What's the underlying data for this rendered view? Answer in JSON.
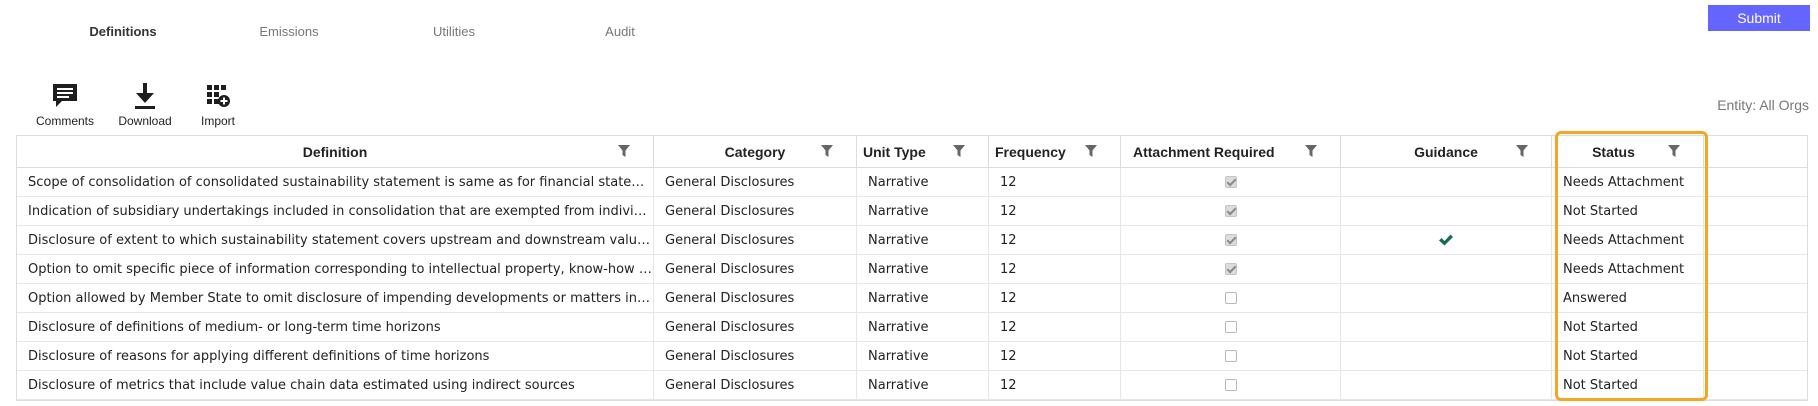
{
  "tabs": [
    {
      "label": "Definitions",
      "active": true
    },
    {
      "label": "Emissions",
      "active": false
    },
    {
      "label": "Utilities",
      "active": false
    },
    {
      "label": "Audit",
      "active": false
    }
  ],
  "submit_label": "Submit",
  "toolbar": {
    "comments_label": "Comments",
    "download_label": "Download",
    "import_label": "Import"
  },
  "entity_label": "Entity: All Orgs",
  "colors": {
    "submit_bg": "#6464ff",
    "highlight": "#f5a623",
    "guidance_check": "#1a6b4a"
  },
  "columns": {
    "definition": "Definition",
    "category": "Category",
    "unit_type": "Unit Type",
    "frequency": "Frequency",
    "attachment_required": "Attachment Required",
    "guidance": "Guidance",
    "status": "Status"
  },
  "rows": [
    {
      "definition": "Scope of consolidation of consolidated sustainability statement is same as for financial statements",
      "category": "General Disclosures",
      "unit_type": "Narrative",
      "frequency": "12",
      "attachment_required": true,
      "guidance": false,
      "status": "Needs Attachment"
    },
    {
      "definition": "Indication of subsidiary undertakings included in consolidation that are exempted from individual or consolidated sustainability reporting",
      "category": "General Disclosures",
      "unit_type": "Narrative",
      "frequency": "12",
      "attachment_required": true,
      "guidance": false,
      "status": "Not Started"
    },
    {
      "definition": "Disclosure of extent to which sustainability statement covers upstream and downstream value chain",
      "category": "General Disclosures",
      "unit_type": "Narrative",
      "frequency": "12",
      "attachment_required": true,
      "guidance": true,
      "status": "Needs Attachment"
    },
    {
      "definition": "Option to omit specific piece of information corresponding to intellectual property, know-how or results of innovation has been used",
      "category": "General Disclosures",
      "unit_type": "Narrative",
      "frequency": "12",
      "attachment_required": true,
      "guidance": false,
      "status": "Needs Attachment"
    },
    {
      "definition": "Option allowed by Member State to omit disclosure of impending developments or matters in course of negotiation has been used",
      "category": "General Disclosures",
      "unit_type": "Narrative",
      "frequency": "12",
      "attachment_required": false,
      "guidance": false,
      "status": "Answered"
    },
    {
      "definition": "Disclosure of definitions of medium- or long-term time horizons",
      "category": "General Disclosures",
      "unit_type": "Narrative",
      "frequency": "12",
      "attachment_required": false,
      "guidance": false,
      "status": "Not Started"
    },
    {
      "definition": "Disclosure of reasons for applying different definitions of time horizons",
      "category": "General Disclosures",
      "unit_type": "Narrative",
      "frequency": "12",
      "attachment_required": false,
      "guidance": false,
      "status": "Not Started"
    },
    {
      "definition": "Disclosure of metrics that include value chain data estimated using indirect sources",
      "category": "General Disclosures",
      "unit_type": "Narrative",
      "frequency": "12",
      "attachment_required": false,
      "guidance": false,
      "status": "Not Started"
    }
  ]
}
